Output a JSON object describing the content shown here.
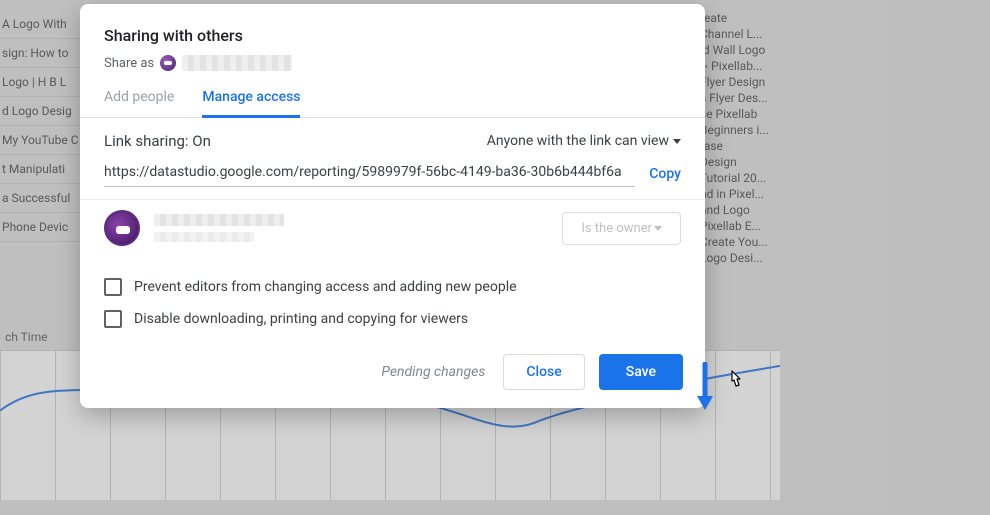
{
  "dialog": {
    "title": "Sharing with others",
    "share_as_label": "Share as",
    "tabs": {
      "add_people": "Add people",
      "manage_access": "Manage access"
    },
    "link_sharing_label": "Link sharing: On",
    "link_permission": "Anyone with the link can view",
    "url": "https://datastudio.google.com/reporting/5989979f-56bc-4149-ba36-30b6b444bf6a",
    "copy": "Copy",
    "owner_role": "Is the owner",
    "opt_prevent": "Prevent editors from changing access and adding new people",
    "opt_disable": "Disable downloading, printing and copying for viewers",
    "pending": "Pending changes",
    "close": "Close",
    "save": "Save"
  },
  "bg": {
    "left": [
      "A Logo With",
      "sign: How to",
      "Logo | H B L",
      "d Logo Desig",
      "My YouTube C",
      "t Manipulati",
      "a Successful",
      "Phone Devic"
    ],
    "right": [
      "reate",
      "Channel L...",
      "ld Wall Logo",
      "~ Pixellab...",
      "Flyer Design",
      "s Flyer Des...",
      "se Pixellab",
      "Beginners i...",
      "rase",
      "Design",
      "Tutorial 20...",
      "nd in Pixel...",
      "and Logo",
      "Pixellab E...",
      "Create You...",
      "Logo Desi..."
    ],
    "watch_label": "ch Time"
  }
}
